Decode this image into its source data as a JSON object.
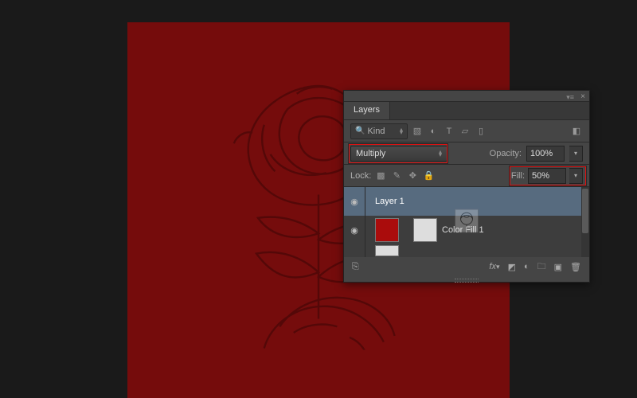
{
  "canvas": {
    "bg": "#750c0c"
  },
  "panel": {
    "tab": "Layers",
    "filter": {
      "kind": "Kind",
      "icons": [
        "image",
        "fx-circle",
        "text",
        "shape",
        "smart",
        "copy"
      ]
    },
    "blend": {
      "mode": "Multiply",
      "opacity_label": "Opacity:",
      "opacity_value": "100%"
    },
    "lock": {
      "label": "Lock:",
      "fill_label": "Fill:",
      "fill_value": "50%"
    },
    "layers": [
      {
        "visible": true,
        "name": "Layer 1",
        "selected": true,
        "kind": "image"
      },
      {
        "visible": true,
        "name": "Color Fill 1",
        "selected": false,
        "kind": "fill"
      }
    ],
    "footer_icons": [
      "link",
      "fx",
      "mask",
      "adjust",
      "group",
      "new",
      "trash"
    ]
  },
  "highlights": [
    "blend-mode",
    "fill-field"
  ]
}
